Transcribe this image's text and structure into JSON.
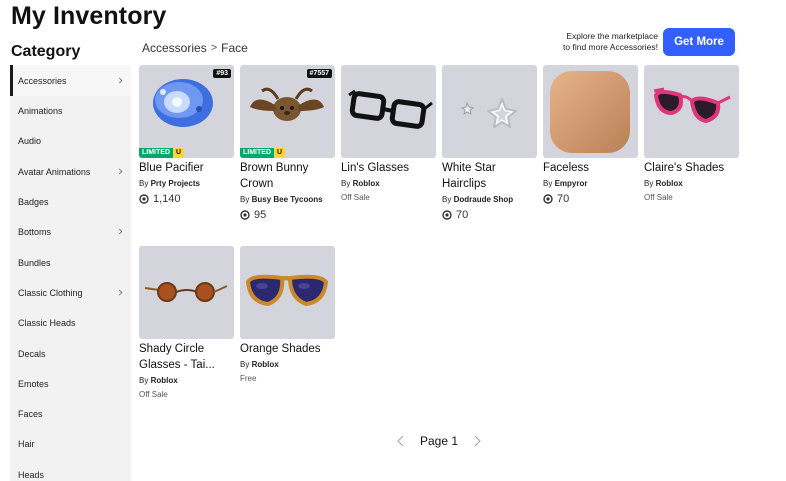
{
  "page": {
    "title": "My Inventory",
    "category_heading": "Category"
  },
  "sidebar": {
    "items": [
      {
        "label": "Accessories",
        "chevron": true,
        "active": true
      },
      {
        "label": "Animations",
        "chevron": false
      },
      {
        "label": "Audio",
        "chevron": false
      },
      {
        "label": "Avatar Animations",
        "chevron": true
      },
      {
        "label": "Badges",
        "chevron": false
      },
      {
        "label": "Bottoms",
        "chevron": true
      },
      {
        "label": "Bundles",
        "chevron": false
      },
      {
        "label": "Classic Clothing",
        "chevron": true
      },
      {
        "label": "Classic Heads",
        "chevron": false
      },
      {
        "label": "Decals",
        "chevron": false
      },
      {
        "label": "Emotes",
        "chevron": false
      },
      {
        "label": "Faces",
        "chevron": false
      },
      {
        "label": "Hair",
        "chevron": false
      },
      {
        "label": "Heads",
        "chevron": false
      }
    ]
  },
  "breadcrumb": {
    "parent": "Accessories",
    "separator": ">",
    "current": "Face"
  },
  "marketplace": {
    "explore_line1": "Explore the marketplace",
    "explore_line2": "to find more Accessories!",
    "button_label": "Get More",
    "button_color": "#335fff"
  },
  "items": [
    {
      "name": "Blue Pacifier",
      "by": "By",
      "creator": "Prty Projects",
      "price": "1,140",
      "serial": "#93",
      "limited": "LIMITED",
      "limited_u": "U"
    },
    {
      "name": "Brown Bunny Crown",
      "by": "By",
      "creator": "Busy Bee Tycoons",
      "price": "95",
      "serial": "#7557",
      "limited": "LIMITED",
      "limited_u": "U"
    },
    {
      "name": "Lin's Glasses",
      "by": "By",
      "creator": "Roblox",
      "status": "Off Sale"
    },
    {
      "name": "White Star Hairclips",
      "by": "By",
      "creator": "Dodraude Shop",
      "price": "70"
    },
    {
      "name": "Faceless",
      "by": "By",
      "creator": "Empyror",
      "price": "70"
    },
    {
      "name": "Claire's Shades",
      "by": "By",
      "creator": "Roblox",
      "status": "Off Sale"
    },
    {
      "name": "Shady Circle Glasses - Tai...",
      "by": "By",
      "creator": "Roblox",
      "status": "Off Sale"
    },
    {
      "name": "Orange Shades",
      "by": "By",
      "creator": "Roblox",
      "status": "Free"
    }
  ],
  "pagination": {
    "label": "Page 1"
  },
  "colors": {
    "limited_green": "#00a86b",
    "limited_yellow": "#ffd43b",
    "thumb_bg": "#d4d5dc"
  }
}
